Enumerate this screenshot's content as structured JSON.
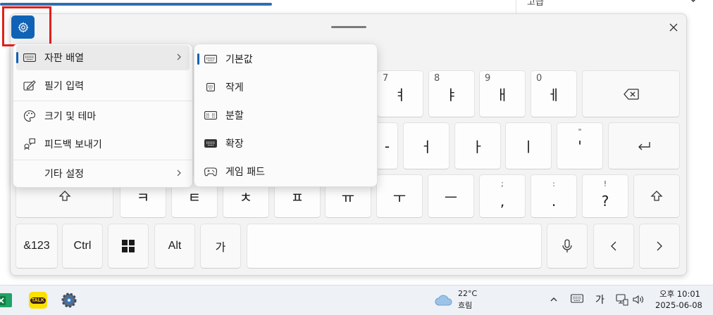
{
  "background": {
    "corner_text": "고급"
  },
  "keyboard": {
    "row1": [
      {
        "sub": "7",
        "main": "ㅕ"
      },
      {
        "sub": "8",
        "main": "ㅑ"
      },
      {
        "sub": "9",
        "main": "ㅐ"
      },
      {
        "sub": "0",
        "main": "ㅔ"
      }
    ],
    "row2": [
      {
        "main": "ㅓ"
      },
      {
        "main": "ㅏ"
      },
      {
        "main": "ㅣ"
      },
      {
        "top": "\"",
        "main": "'"
      }
    ],
    "row3": [
      "ㅋ",
      "ㅌ",
      "ㅊ",
      "ㅍ",
      "ㅠ",
      "ㅜ",
      "ㅡ"
    ],
    "row3_punct": [
      {
        "top": ";",
        "main": ","
      },
      {
        "top": ":",
        "main": "."
      },
      {
        "top": "!",
        "main": "?"
      }
    ],
    "row4": {
      "numbers": "&123",
      "ctrl": "Ctrl",
      "alt": "Alt",
      "lang": "가"
    }
  },
  "menu": {
    "items": [
      {
        "label": "자판 배열",
        "icon": "keyboard-layout-icon"
      },
      {
        "label": "필기 입력",
        "icon": "handwriting-icon"
      },
      {
        "label": "크기 및 테마",
        "icon": "palette-icon"
      },
      {
        "label": "피드백 보내기",
        "icon": "feedback-icon"
      },
      {
        "label": "기타 설정",
        "icon": ""
      }
    ]
  },
  "submenu": {
    "items": [
      {
        "label": "기본값",
        "icon": "keyboard-default-icon"
      },
      {
        "label": "작게",
        "icon": "keyboard-small-icon"
      },
      {
        "label": "분할",
        "icon": "keyboard-split-icon"
      },
      {
        "label": "확장",
        "icon": "keyboard-extended-icon"
      },
      {
        "label": "게임 패드",
        "icon": "gamepad-icon"
      }
    ]
  },
  "taskbar": {
    "weather_temp": "22°C",
    "weather_desc": "흐림",
    "ime": "가",
    "time": "오후 10:01",
    "date": "2025-06-08",
    "kakao_label": "TALK"
  }
}
